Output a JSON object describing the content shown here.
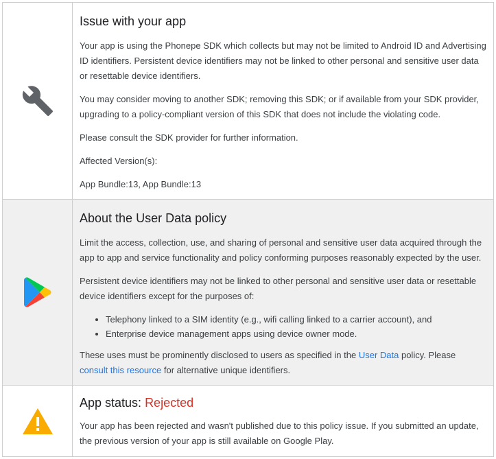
{
  "issue": {
    "title": "Issue with your app",
    "p1": "Your app is using the Phonepe SDK which collects but may not be limited to Android ID and Advertising ID identifiers. Persistent device identifiers may not be linked to other personal and sensitive user data or resettable device identifiers.",
    "p2": "You may consider moving to another SDK; removing this SDK; or if available from your SDK provider, upgrading to a policy-compliant version of this SDK that does not include the violating code.",
    "p3": "Please consult the SDK provider for further information.",
    "affected_label": "Affected Version(s):",
    "affected_versions": "App Bundle:13, App Bundle:13"
  },
  "policy": {
    "title": "About the User Data policy",
    "p1": "Limit the access, collection, use, and sharing of personal and sensitive user data acquired through the app to app and service functionality and policy conforming purposes reasonably expected by the user.",
    "p2": "Persistent device identifiers may not be linked to other personal and sensitive user data or resettable device identifiers except for the purposes of:",
    "bullets": [
      "Telephony linked to a SIM identity (e.g., wifi calling linked to a carrier account), and",
      "Enterprise device management apps using device owner mode."
    ],
    "p3_before": "These uses must be prominently disclosed to users as specified in the ",
    "link_user_data": "User Data",
    "p3_middle": " policy. Please ",
    "link_consult": "consult this resource",
    "p3_after": " for alternative unique identifiers."
  },
  "status": {
    "label": "App status: ",
    "value": "Rejected",
    "text": "Your app has been rejected and wasn't published due to this policy issue. If you submitted an update, the previous version of your app is still available on Google Play."
  },
  "colors": {
    "rejected": "#d93025",
    "link": "#1a73e8",
    "warning": "#f9ab00"
  },
  "icons": [
    "wrench-icon",
    "google-play-icon",
    "warning-icon"
  ]
}
